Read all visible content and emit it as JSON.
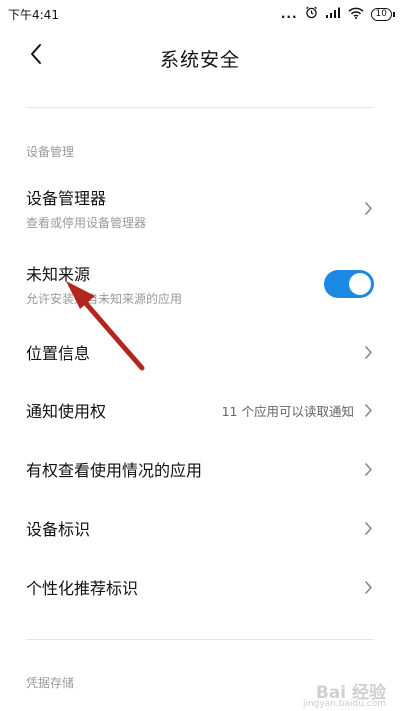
{
  "status_bar": {
    "time": "下午4:41",
    "battery": "10",
    "dots": "..."
  },
  "header": {
    "title": "系统安全"
  },
  "sections": [
    {
      "label": "设备管理"
    },
    {
      "label": "凭据存储"
    }
  ],
  "rows": [
    {
      "title": "设备管理器",
      "subtitle": "查看或停用设备管理器"
    },
    {
      "title": "未知来源",
      "subtitle": "允许安装来自未知来源的应用",
      "toggle_on": true
    },
    {
      "title": "位置信息"
    },
    {
      "title": "通知使用权",
      "value": "11 个应用可以读取通知"
    },
    {
      "title": "有权查看使用情况的应用"
    },
    {
      "title": "设备标识"
    },
    {
      "title": "个性化推荐标识"
    }
  ],
  "annotation": {
    "arrow_color": "#b3261e"
  },
  "colors": {
    "accent": "#1e88e5",
    "annotation": "#b3261e"
  },
  "watermark": {
    "text": "Bai 经验",
    "sub": "jingyan.baidu.com"
  }
}
